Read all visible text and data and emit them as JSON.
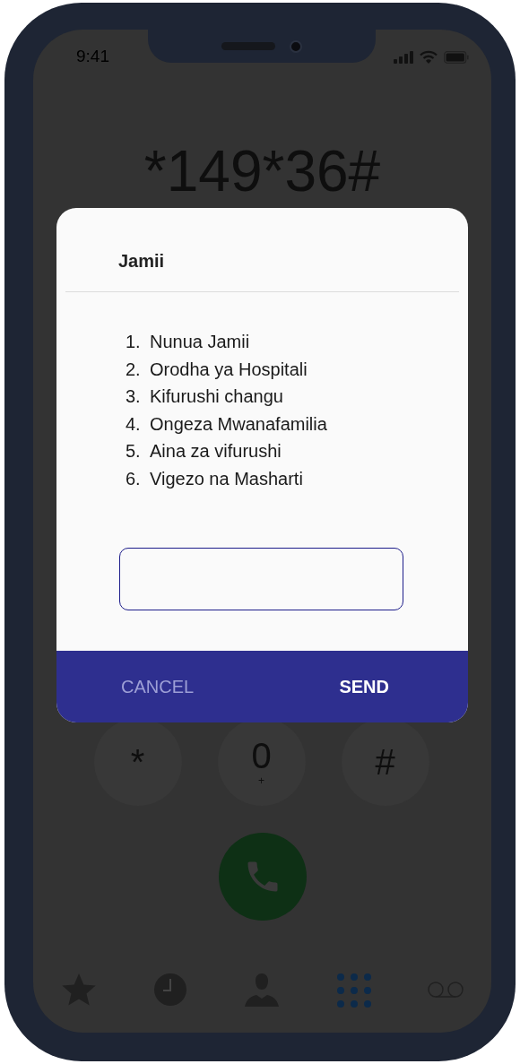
{
  "status_bar": {
    "time": "9:41"
  },
  "dialed_number": "*149*36#",
  "keypad": [
    {
      "digit": "*"
    },
    {
      "digit": "0",
      "letters": "+"
    },
    {
      "digit": "#"
    }
  ],
  "tabs": [
    {
      "kind": "favorites",
      "selected": false
    },
    {
      "kind": "recents",
      "selected": false
    },
    {
      "kind": "contacts",
      "selected": false
    },
    {
      "kind": "keypad",
      "selected": true
    },
    {
      "kind": "voicemail",
      "selected": false
    }
  ],
  "dialog": {
    "title": "Jamii",
    "options": [
      {
        "number": "1.",
        "label": "Nunua Jamii"
      },
      {
        "number": "2.",
        "label": "Orodha ya Hospitali"
      },
      {
        "number": "3.",
        "label": "Kifurushi changu"
      },
      {
        "number": "4.",
        "label": "Ongeza Mwanafamilia"
      },
      {
        "number": "5.",
        "label": "Aina za vifurushi"
      },
      {
        "number": "6.",
        "label": "Vigezo na Masharti"
      }
    ],
    "buttons": [
      {
        "kind": "cancel",
        "label": "CANCEL"
      },
      {
        "kind": "send",
        "label": "SEND"
      }
    ]
  }
}
